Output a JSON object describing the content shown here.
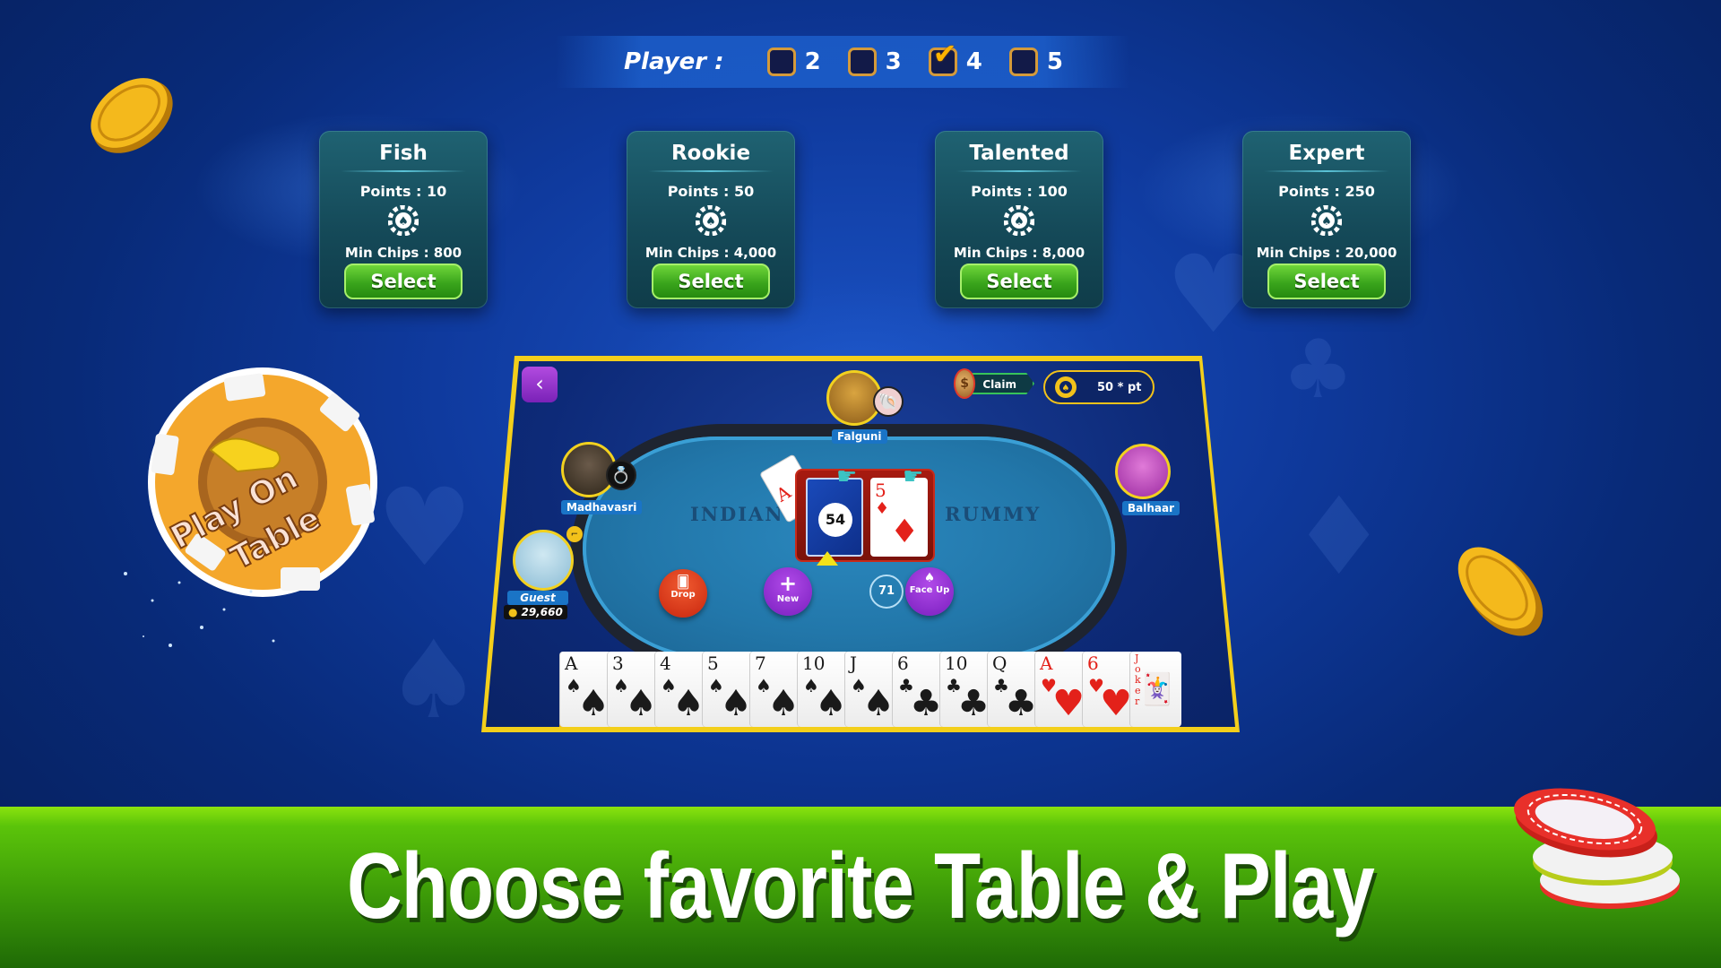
{
  "player_select": {
    "label": "Player :",
    "options": [
      {
        "value": "2",
        "checked": false
      },
      {
        "value": "3",
        "checked": false
      },
      {
        "value": "4",
        "checked": true
      },
      {
        "value": "5",
        "checked": false
      }
    ]
  },
  "tables": [
    {
      "name": "Fish",
      "points": "Points : 10",
      "min_chips": "Min Chips : 800",
      "button": "Select"
    },
    {
      "name": "Rookie",
      "points": "Points : 50",
      "min_chips": "Min Chips : 4,000",
      "button": "Select"
    },
    {
      "name": "Talented",
      "points": "Points : 100",
      "min_chips": "Min Chips : 8,000",
      "button": "Select"
    },
    {
      "name": "Expert",
      "points": "Points : 250",
      "min_chips": "Min Chips : 20,000",
      "button": "Select"
    }
  ],
  "badge": {
    "line1": "Play On",
    "line2": "Table"
  },
  "game": {
    "back_icon": "‹",
    "claim_label": "Claim",
    "point_value": "50 * pt",
    "table_text_left": "INDIAN",
    "table_text_right": "RUMMY",
    "players": {
      "top": "Falguni",
      "left": "Madhavasri",
      "right": "Balhaar",
      "self": "Guest",
      "self_chips": "29,660"
    },
    "deck_count": "54",
    "open_card": {
      "rank": "5",
      "suit": "♦"
    },
    "discard_card": {
      "rank": "A",
      "suit": "♦"
    },
    "actions": {
      "drop": "Drop",
      "new": "New",
      "face_up": "Face Up"
    },
    "cards_left": "71",
    "hand": [
      {
        "rank": "A",
        "suit": "♠",
        "color": "black"
      },
      {
        "rank": "3",
        "suit": "♠",
        "color": "black"
      },
      {
        "rank": "4",
        "suit": "♠",
        "color": "black"
      },
      {
        "rank": "5",
        "suit": "♠",
        "color": "black"
      },
      {
        "rank": "7",
        "suit": "♠",
        "color": "black"
      },
      {
        "rank": "10",
        "suit": "♠",
        "color": "black"
      },
      {
        "rank": "J",
        "suit": "♠",
        "color": "black"
      },
      {
        "rank": "6",
        "suit": "♣",
        "color": "black"
      },
      {
        "rank": "10",
        "suit": "♣",
        "color": "black"
      },
      {
        "rank": "Q",
        "suit": "♣",
        "color": "black"
      },
      {
        "rank": "A",
        "suit": "♥",
        "color": "red"
      },
      {
        "rank": "6",
        "suit": "♥",
        "color": "red"
      },
      {
        "rank": "Joker",
        "suit": "",
        "color": "red"
      }
    ]
  },
  "banner": {
    "headline": "Choose favorite Table & Play"
  },
  "colors": {
    "accent_green": "#3aa51c",
    "frame_yellow": "#f3cf1b",
    "felt_blue": "#2277aa",
    "tier_teal": "#154a59"
  }
}
